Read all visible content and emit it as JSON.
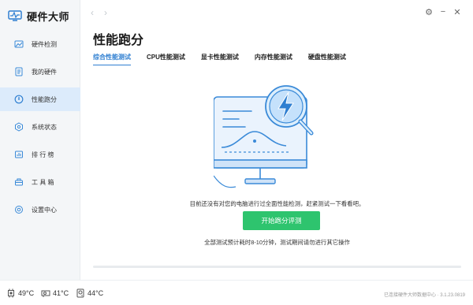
{
  "app": {
    "name": "硬件大师"
  },
  "sidebar": {
    "items": [
      {
        "label": "硬件检测",
        "icon": "image-icon"
      },
      {
        "label": "我的硬件",
        "icon": "document-icon"
      },
      {
        "label": "性能跑分",
        "icon": "gauge-icon",
        "active": true
      },
      {
        "label": "系统状态",
        "icon": "hexagon-icon"
      },
      {
        "label": "排 行 榜",
        "icon": "chart-icon"
      },
      {
        "label": "工 具 箱",
        "icon": "toolbox-icon"
      },
      {
        "label": "设置中心",
        "icon": "settings-icon"
      }
    ]
  },
  "main": {
    "title": "性能跑分",
    "tabs": [
      {
        "label": "综合性能测试",
        "active": true
      },
      {
        "label": "CPU性能测试"
      },
      {
        "label": "显卡性能测试"
      },
      {
        "label": "内存性能测试"
      },
      {
        "label": "硬盘性能测试"
      }
    ],
    "message": "目前还没有对您的电脑进行过全面性能检测，赶紧测试一下看看吧。",
    "start_button": "开始跑分评测",
    "duration_note": "全部测试预计耗时8-10分钟，测试期间请勿进行其它操作",
    "progress": 0
  },
  "window": {
    "back": "‹",
    "forward": "›",
    "settings_icon": "⚙",
    "minimize_icon": "−",
    "close_icon": "✕"
  },
  "status": {
    "cpu_temp": "49°C",
    "gpu_temp": "41°C",
    "disk_temp": "44°C",
    "server_status": "已连接硬件大师数据中心 · 3.1.23.0819"
  },
  "colors": {
    "accent": "#2f7fd1",
    "button": "#2ec46e",
    "sidebar_active": "#dcebfb"
  }
}
